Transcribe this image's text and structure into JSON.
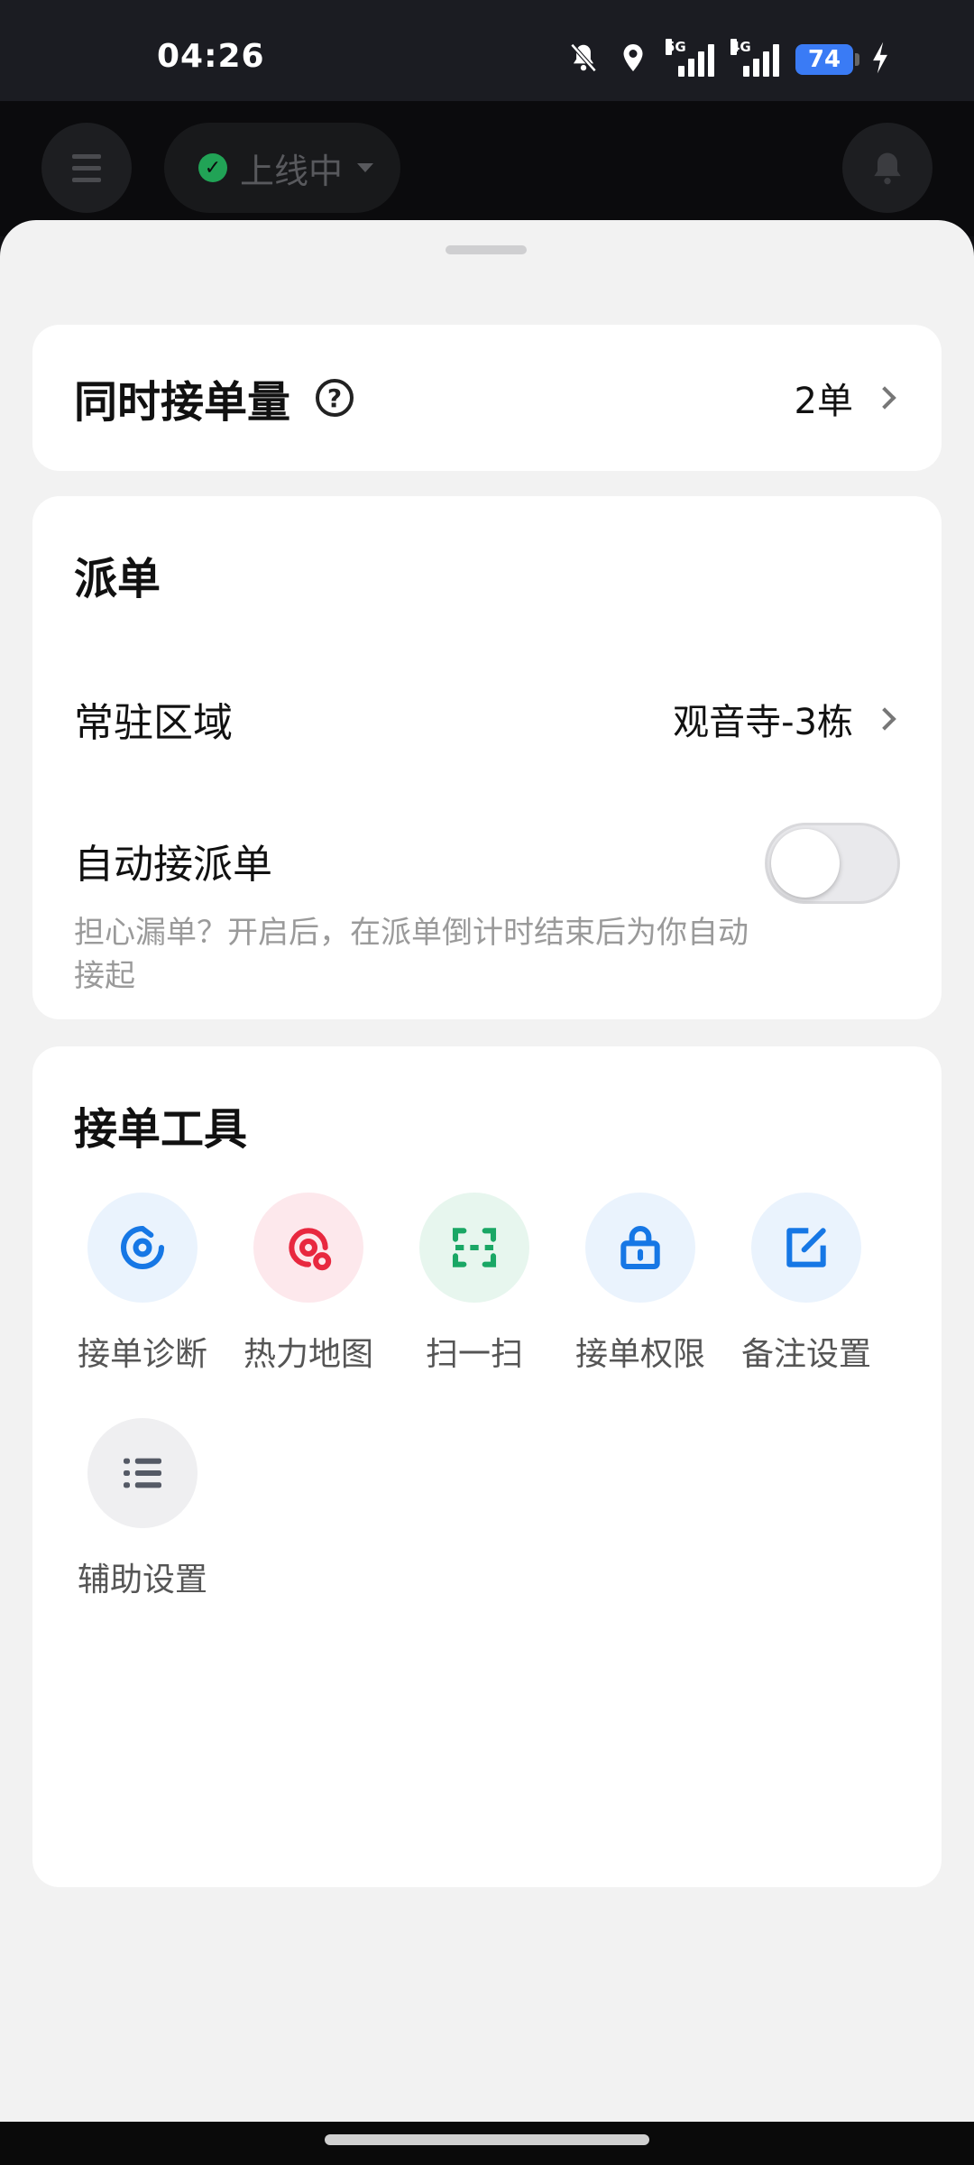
{
  "status_bar": {
    "time": "04:26",
    "battery": "74",
    "net1": "5G",
    "net2": "4G",
    "icons": [
      "mute-icon",
      "location-icon",
      "signal-5g-icon",
      "signal-4g-icon",
      "battery-icon",
      "charging-icon"
    ]
  },
  "header": {
    "status_label": "上线中",
    "status_color": "#21a356"
  },
  "concurrent": {
    "label": "同时接单量",
    "help_symbol": "?",
    "value": "2单"
  },
  "dispatch": {
    "title": "派单",
    "region_label": "常驻区域",
    "region_value": "观音寺-3栋",
    "auto_label": "自动接派单",
    "auto_on": false,
    "auto_desc": "担心漏单？开启后，在派单倒计时结束后为你自动接起"
  },
  "tools": {
    "title": "接单工具",
    "items": [
      {
        "label": "接单诊断",
        "icon": "diagnosis-icon",
        "color": "#1677e5",
        "bg": "#eaf3fd"
      },
      {
        "label": "热力地图",
        "icon": "heatmap-icon",
        "color": "#e8283f",
        "bg": "#fde8ec"
      },
      {
        "label": "扫一扫",
        "icon": "scan-icon",
        "color": "#1aa765",
        "bg": "#e7f6ee"
      },
      {
        "label": "接单权限",
        "icon": "lock-icon",
        "color": "#1677e5",
        "bg": "#eaf3fd"
      },
      {
        "label": "备注设置",
        "icon": "edit-note-icon",
        "color": "#1677e5",
        "bg": "#eaf3fd"
      },
      {
        "label": "辅助设置",
        "icon": "list-icon",
        "color": "#555a66",
        "bg": "#efeff1"
      }
    ]
  }
}
